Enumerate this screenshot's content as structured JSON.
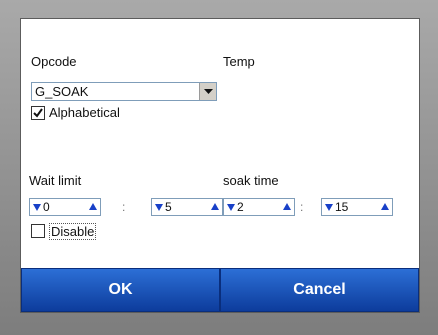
{
  "form": {
    "opcode_label": "Opcode",
    "temp_label": "Temp",
    "opcode_value": "G_SOAK",
    "alphabetical_label": "Alphabetical",
    "alphabetical_checked": true,
    "wait_limit_label": "Wait limit",
    "soak_time_label": "soak time",
    "wait_hours": "0",
    "wait_minutes": "5",
    "soak_hours": "2",
    "soak_minutes": "15",
    "time_separator": ":",
    "disable_label": "Disable",
    "disable_checked": false
  },
  "buttons": {
    "ok_label": "OK",
    "cancel_label": "Cancel"
  },
  "colors": {
    "button_blue": "#1a56c4",
    "arrow_blue": "#1840c8"
  },
  "icons": {
    "dropdown": "chevron-down-icon",
    "spin_down": "arrow-down-icon",
    "spin_up": "arrow-up-icon",
    "check": "checkmark-icon"
  }
}
